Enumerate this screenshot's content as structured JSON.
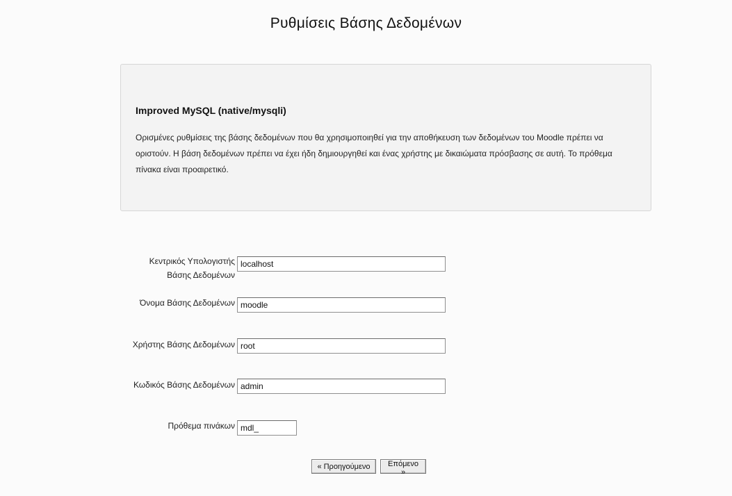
{
  "page": {
    "title": "Ρυθμίσεις Βάσης Δεδομένων"
  },
  "info": {
    "heading": "Improved MySQL (native/mysqli)",
    "text": "Ορισμένες ρυθμίσεις της βάσης δεδομένων που θα χρησιμοποιηθεί για την αποθήκευση των δεδομένων του Moodle πρέπει να οριστούν. Η βάση δεδομένων πρέπει να έχει ήδη δημιουργηθεί και ένας χρήστης με δικαιώματα πρόσβασης σε αυτή. Το πρόθεμα πίνακα είναι προαιρετικό."
  },
  "form": {
    "fields": [
      {
        "label": "Κεντρικός Υπολογιστής Βάσης Δεδομένων",
        "value": "localhost"
      },
      {
        "label": "Όνομα Βάσης Δεδομένων",
        "value": "moodle"
      },
      {
        "label": "Χρήστης Βάσης Δεδομένων",
        "value": "root"
      },
      {
        "label": "Κωδικός Βάσης Δεδομένων",
        "value": "admin"
      },
      {
        "label": "Πρόθεμα πινάκων",
        "value": "mdl_"
      }
    ],
    "buttons": {
      "previous": "« Προηγούμενο",
      "next": "Επόμενο »"
    }
  }
}
